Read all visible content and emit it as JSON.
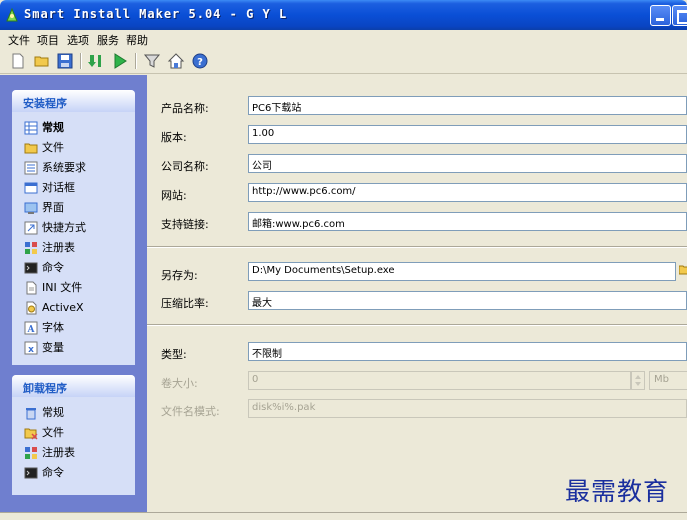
{
  "window": {
    "title": "Smart Install Maker 5.04 - G Y L"
  },
  "menu": [
    "文件",
    "项目",
    "选项",
    "服务",
    "帮助"
  ],
  "toolbar": {
    "icons": [
      "new-file-icon",
      "open-folder-icon",
      "save-icon",
      "build-icon",
      "run-icon",
      "filter-icon",
      "home-icon",
      "help-icon"
    ]
  },
  "install_group": {
    "title": "安装程序",
    "items": [
      "常规",
      "文件",
      "系统要求",
      "对话框",
      "界面",
      "快捷方式",
      "注册表",
      "命令",
      "INI 文件",
      "ActiveX",
      "字体",
      "变量"
    ]
  },
  "uninstall_group": {
    "title": "卸载程序",
    "items": [
      "常规",
      "文件",
      "注册表",
      "命令"
    ]
  },
  "form": {
    "product_name_label": "产品名称:",
    "product_name": "PC6下载站",
    "version_label": "版本:",
    "version": "1.00",
    "company_label": "公司名称:",
    "company": "公司",
    "website_label": "网站:",
    "website": "http://www.pc6.com/",
    "support_label": "支持链接:",
    "support": "邮箱:www.pc6.com",
    "save_as_label": "另存为:",
    "save_as": "D:\\My Documents\\Setup.exe",
    "compression_label": "压缩比率:",
    "compression": "最大",
    "type_label": "类型:",
    "type": "不限制",
    "volume_size_label": "卷大小:",
    "volume_size": "0",
    "volume_unit": "Mb",
    "filename_pattern_label": "文件名模式:",
    "filename_pattern": "disk%i%.pak"
  },
  "watermark": "最需教育",
  "colors": {
    "titlebar": "#0a4fd6",
    "panel": "#6f7fcf",
    "group_title": "#215dc6"
  }
}
